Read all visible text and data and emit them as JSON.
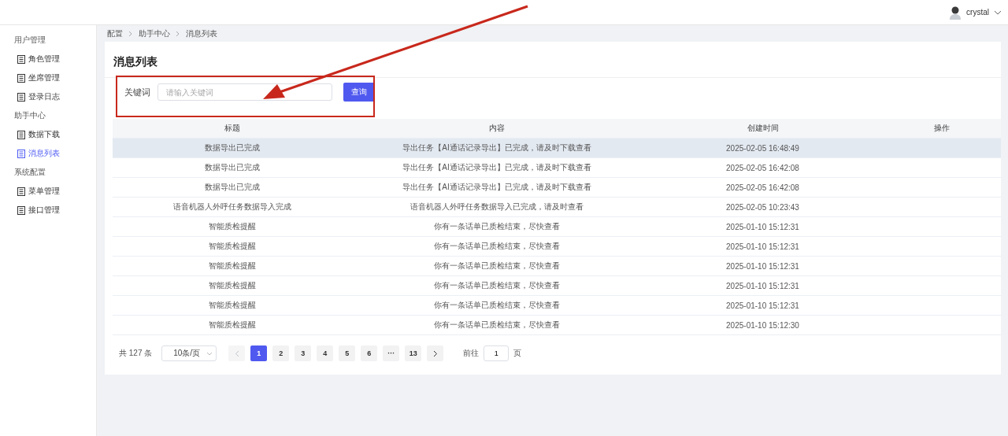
{
  "header": {
    "username": "crystal"
  },
  "sidebar": {
    "groups": [
      {
        "label": "用户管理",
        "items": [
          {
            "label": "角色管理",
            "selected": false
          },
          {
            "label": "坐席管理",
            "selected": false
          },
          {
            "label": "登录日志",
            "selected": false
          }
        ]
      },
      {
        "label": "助手中心",
        "items": [
          {
            "label": "数据下载",
            "selected": false
          },
          {
            "label": "消息列表",
            "selected": true
          }
        ]
      },
      {
        "label": "系统配置",
        "items": [
          {
            "label": "菜单管理",
            "selected": false
          },
          {
            "label": "接口管理",
            "selected": false
          }
        ]
      }
    ]
  },
  "breadcrumb": [
    "配置",
    "助手中心",
    "消息列表"
  ],
  "page_title": "消息列表",
  "filter": {
    "label": "关键词",
    "placeholder": "请输入关键词",
    "button": "查询"
  },
  "table": {
    "columns": [
      "标题",
      "内容",
      "创建时间",
      "操作"
    ],
    "rows": [
      {
        "highlighted": true,
        "cells": [
          "数据导出已完成",
          "导出任务【AI通话记录导出】已完成，请及时下载查看",
          "2025-02-05 16:48:49"
        ]
      },
      {
        "highlighted": false,
        "cells": [
          "数据导出已完成",
          "导出任务【AI通话记录导出】已完成，请及时下载查看",
          "2025-02-05 16:42:08"
        ]
      },
      {
        "highlighted": false,
        "cells": [
          "数据导出已完成",
          "导出任务【AI通话记录导出】已完成，请及时下载查看",
          "2025-02-05 16:42:08"
        ]
      },
      {
        "highlighted": false,
        "cells": [
          "语音机器人外呼任务数据导入完成",
          "语音机器人外呼任务数据导入已完成，请及时查看",
          "2025-02-05 10:23:43"
        ]
      },
      {
        "highlighted": false,
        "cells": [
          "智能质检提醒",
          "你有一条话单已质检结束，尽快查看",
          "2025-01-10 15:12:31"
        ]
      },
      {
        "highlighted": false,
        "cells": [
          "智能质检提醒",
          "你有一条话单已质检结束，尽快查看",
          "2025-01-10 15:12:31"
        ]
      },
      {
        "highlighted": false,
        "cells": [
          "智能质检提醒",
          "你有一条话单已质检结束，尽快查看",
          "2025-01-10 15:12:31"
        ]
      },
      {
        "highlighted": false,
        "cells": [
          "智能质检提醒",
          "你有一条话单已质检结束，尽快查看",
          "2025-01-10 15:12:31"
        ]
      },
      {
        "highlighted": false,
        "cells": [
          "智能质检提醒",
          "你有一条话单已质检结束，尽快查看",
          "2025-01-10 15:12:31"
        ]
      },
      {
        "highlighted": false,
        "cells": [
          "智能质检提醒",
          "你有一条话单已质检结束，尽快查看",
          "2025-01-10 15:12:30"
        ]
      }
    ]
  },
  "pagination": {
    "total": "共 127 条",
    "page_size": "10条/页",
    "prev_disabled": true,
    "next_disabled": false,
    "pages": [
      {
        "label": "1",
        "selected": true
      },
      {
        "label": "2",
        "selected": false
      },
      {
        "label": "3",
        "selected": false
      },
      {
        "label": "4",
        "selected": false
      },
      {
        "label": "5",
        "selected": false
      },
      {
        "label": "6",
        "selected": false
      },
      {
        "label": "···",
        "selected": false
      },
      {
        "label": "13",
        "selected": false
      }
    ],
    "goto_label": "前往",
    "goto_value": "1",
    "goto_unit": "页"
  }
}
